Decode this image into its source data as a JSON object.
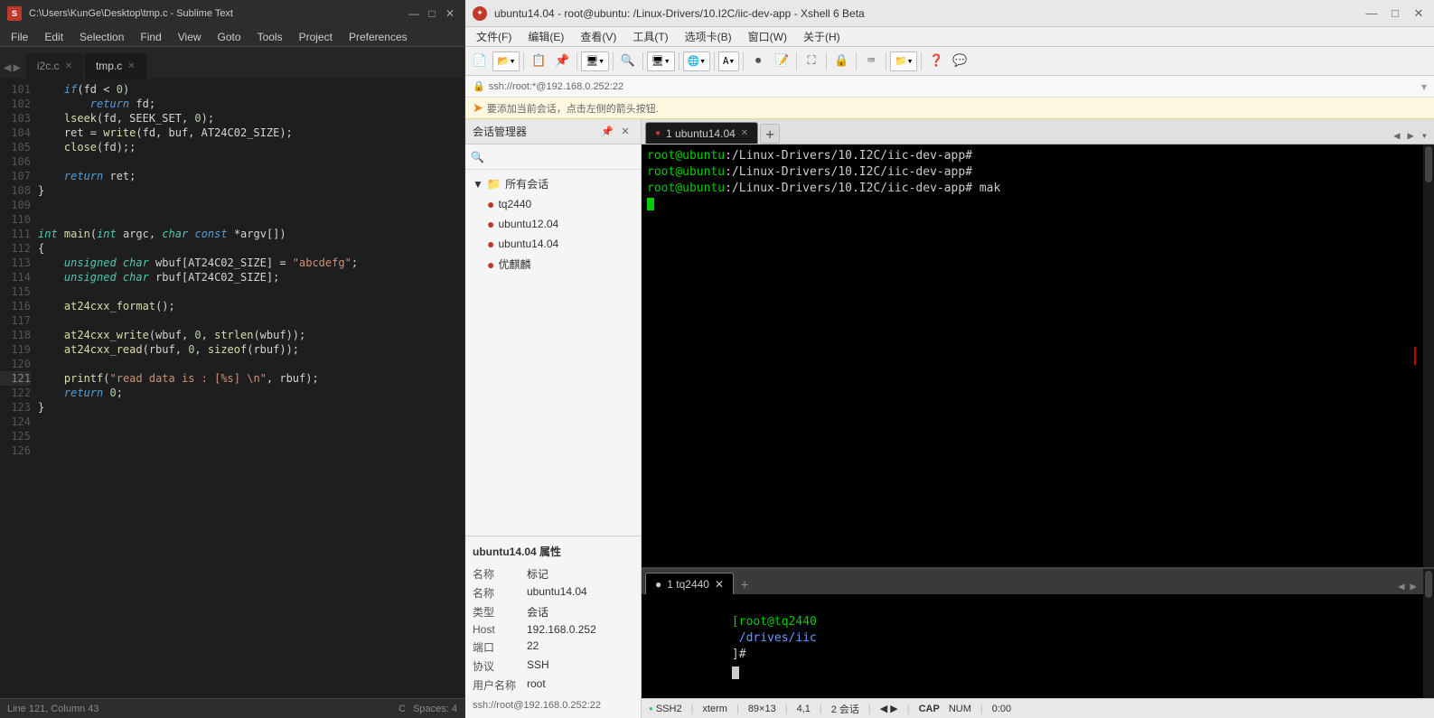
{
  "sublime": {
    "titlebar": {
      "title": "C:\\Users\\KunGe\\Desktop\\tmp.c - Sublime Text",
      "minimize": "—",
      "maximize": "□",
      "close": "✕"
    },
    "menu": {
      "items": [
        "File",
        "Edit",
        "Selection",
        "Find",
        "View",
        "Goto",
        "Tools",
        "Project",
        "Preferences"
      ]
    },
    "tabs": {
      "tab1": {
        "label": "i2c.c",
        "active": false
      },
      "tab2": {
        "label": "tmp.c",
        "active": true
      }
    },
    "code_lines": [
      {
        "num": "101",
        "content": "    if(fd < 0)"
      },
      {
        "num": "102",
        "content": "        return fd;"
      },
      {
        "num": "103",
        "content": "    lseek(fd, SEEK_SET, 0);"
      },
      {
        "num": "104",
        "content": "    ret = write(fd, buf, AT24C02_SIZE);"
      },
      {
        "num": "105",
        "content": "    close(fd);;"
      },
      {
        "num": "106",
        "content": ""
      },
      {
        "num": "107",
        "content": "    return ret;"
      },
      {
        "num": "108",
        "content": "}"
      },
      {
        "num": "109",
        "content": ""
      },
      {
        "num": "110",
        "content": ""
      },
      {
        "num": "111",
        "content": "int main(int argc, char const *argv[])"
      },
      {
        "num": "112",
        "content": "{"
      },
      {
        "num": "113",
        "content": "    unsigned char wbuf[AT24C02_SIZE] = \"abcdefg\";"
      },
      {
        "num": "114",
        "content": "    unsigned char rbuf[AT24C02_SIZE];"
      },
      {
        "num": "115",
        "content": ""
      },
      {
        "num": "116",
        "content": "    at24cxx_format();"
      },
      {
        "num": "117",
        "content": ""
      },
      {
        "num": "118",
        "content": "    at24cxx_write(wbuf, 0, strlen(wbuf));"
      },
      {
        "num": "119",
        "content": "    at24cxx_read(rbuf, 0, sizeof(rbuf));"
      },
      {
        "num": "120",
        "content": ""
      },
      {
        "num": "121",
        "content": "    printf(\"read data is : [%s] \\n\", rbuf);"
      },
      {
        "num": "122",
        "content": "    return 0;"
      },
      {
        "num": "123",
        "content": "}"
      },
      {
        "num": "124",
        "content": ""
      },
      {
        "num": "125",
        "content": ""
      },
      {
        "num": "126",
        "content": ""
      }
    ],
    "statusbar": {
      "left": "Line 121, Column 43",
      "right_lang": "C",
      "right_spaces": "Spaces: 4"
    }
  },
  "xshell": {
    "titlebar": {
      "title": "ubuntu14.04 - root@ubuntu: /Linux-Drivers/10.I2C/iic-dev-app - Xshell 6 Beta",
      "minimize": "—",
      "maximize": "□",
      "close": "✕"
    },
    "menu": {
      "items": [
        "文件(F)",
        "编辑(E)",
        "查看(V)",
        "工具(T)",
        "选项卡(B)",
        "窗口(W)",
        "关于(H)"
      ]
    },
    "address_bar": {
      "text": "ssh://root:*@192.168.0.252:22"
    },
    "info_bar": {
      "text": "要添加当前会话，点击左侧的箭头按钮."
    },
    "session_manager": {
      "title": "会话管理器",
      "all_sessions": "所有会话",
      "sessions": [
        "tq2440",
        "ubuntu12.04",
        "ubuntu14.04",
        "优麒麟"
      ]
    },
    "properties": {
      "title": "ubuntu14.04 属性",
      "rows": [
        {
          "label": "名称",
          "tag": "标记"
        },
        {
          "label": "名称",
          "value": "ubuntu14.04"
        },
        {
          "label": "类型",
          "value": "会话"
        },
        {
          "label": "Host",
          "value": "192.168.0.252"
        },
        {
          "label": "端口",
          "value": "22"
        },
        {
          "label": "协议",
          "value": "SSH"
        },
        {
          "label": "用户名称",
          "value": "root"
        }
      ],
      "footer": "ssh://root@192.168.0.252:22"
    },
    "terminal_top": {
      "tab": "1 ubuntu14.04",
      "lines": [
        "root@ubuntu:/Linux-Drivers/10.I2C/iic-dev-app#",
        "root@ubuntu:/Linux-Drivers/10.I2C/iic-dev-app#",
        "root@ubuntu:/Linux-Drivers/10.I2C/iic-dev-app# mak"
      ]
    },
    "terminal_bottom": {
      "tab": "1 tq2440",
      "lines": [
        "[root@tq2440 /drives/iic]# "
      ]
    },
    "statusbar": {
      "ssh": "SSH2",
      "term": "xterm",
      "size": "89×13",
      "pos": "4,1",
      "sessions": "2 会话",
      "caps": "CAP",
      "num": "NUM",
      "time": "0:00"
    }
  }
}
